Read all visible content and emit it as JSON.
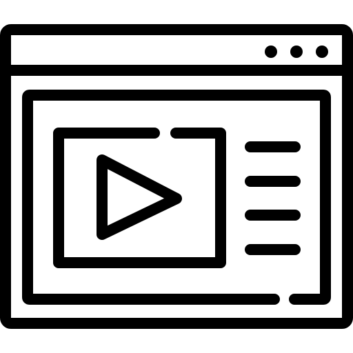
{
  "icon": {
    "name": "video-player-browser-window-icon",
    "stroke_color": "#000000",
    "fill_color": "#ffffff"
  },
  "window": {
    "title_bar_dots": 3
  },
  "player": {
    "play_icon": "play-triangle-icon",
    "playlist_lines": 4
  }
}
